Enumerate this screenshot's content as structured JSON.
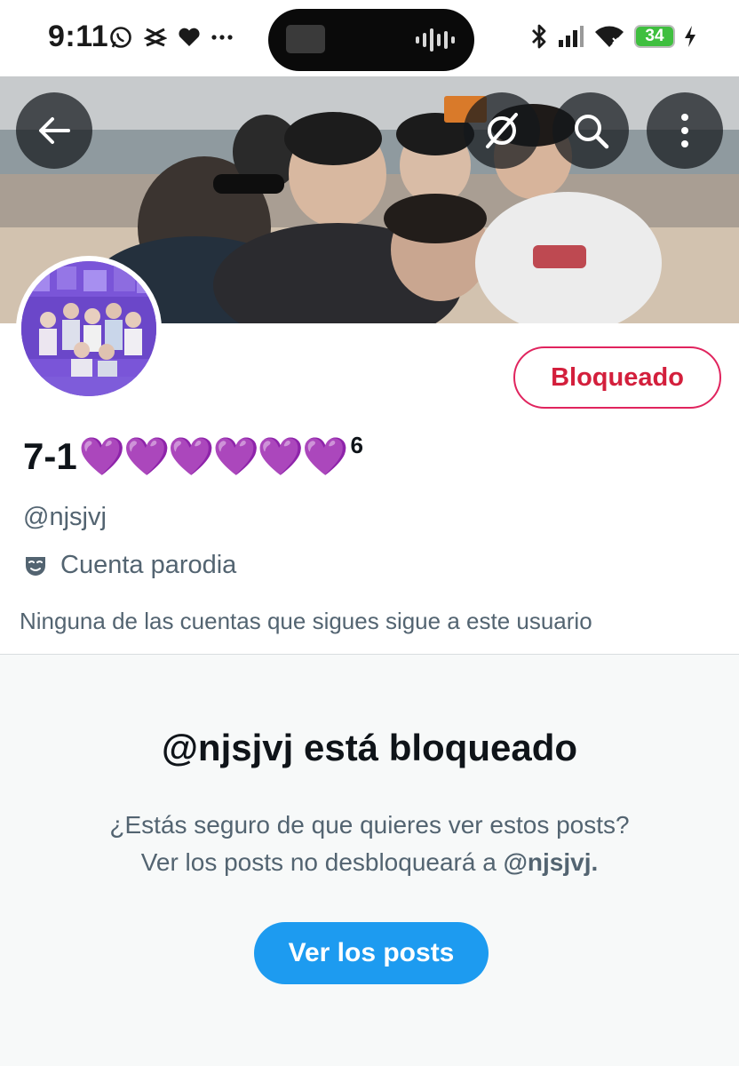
{
  "status_bar": {
    "time": "9:11",
    "left_icons": [
      "whatsapp-icon",
      "capcut-icon",
      "heart-icon",
      "more-dots-icon"
    ],
    "right_icons": [
      "bluetooth-icon",
      "signal-icon",
      "wifi-icon",
      "battery-icon",
      "charging-icon"
    ],
    "battery_level": "34",
    "media_playing": true
  },
  "header": {
    "back_icon": "arrow-left-icon",
    "grok_icon": "grok-icon",
    "search_icon": "search-icon",
    "more_icon": "more-vertical-icon"
  },
  "profile": {
    "name_prefix": "7-1",
    "name_hearts": "💜💜💜💜💜💜",
    "name_suffix": "6",
    "handle": "@njsjvj",
    "parody_label": "Cuenta parodia",
    "parody_icon": "theater-mask-icon",
    "followers_note": "Ninguna de las cuentas que sigues sigue a este usuario",
    "blocked_button": "Bloqueado"
  },
  "blocked": {
    "title": "@njsjvj está bloqueado",
    "line1": "¿Estás seguro de que quieres ver estos posts?",
    "line2_prefix": "Ver los posts no desbloqueará a",
    "line2_handle": "@njsjvj.",
    "button": "Ver los posts"
  },
  "colors": {
    "text_primary": "#0f1419",
    "text_secondary": "#536471",
    "blocked_red": "#e0245e",
    "accent_blue": "#1d9bf0",
    "heart_purple": "#9b30d9",
    "battery_green": "#3fbf3f",
    "section_bg": "#f7f9f9"
  }
}
